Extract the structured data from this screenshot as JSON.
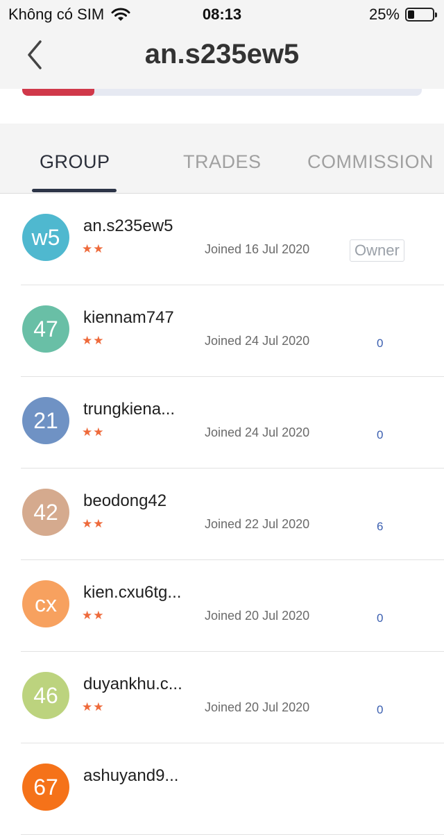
{
  "status_bar": {
    "carrier": "Không có SIM",
    "time": "08:13",
    "battery": "25%",
    "battery_level": 0.25
  },
  "header": {
    "title": "an.s235ew5"
  },
  "progress": {
    "level": 0.18
  },
  "tabs": [
    {
      "label": "GROUP",
      "active": true
    },
    {
      "label": "TRADES",
      "active": false
    },
    {
      "label": "COMMISSION",
      "active": false
    }
  ],
  "members": [
    {
      "initials": "w5",
      "name": "an.s235ew5",
      "stars": "★★",
      "joined": "Joined 16 Jul 2020",
      "badge": "Owner",
      "count": "",
      "color": "#4fb8cf"
    },
    {
      "initials": "47",
      "name": "kiennam747",
      "stars": "★★",
      "joined": "Joined 24 Jul 2020",
      "badge": "",
      "count": "0",
      "color": "#69bfa6"
    },
    {
      "initials": "21",
      "name": "trungkiena...",
      "stars": "★★",
      "joined": "Joined 24 Jul 2020",
      "badge": "",
      "count": "0",
      "color": "#6f92c4"
    },
    {
      "initials": "42",
      "name": "beodong42",
      "stars": "★★",
      "joined": "Joined 22 Jul 2020",
      "badge": "",
      "count": "6",
      "color": "#d5aa8e"
    },
    {
      "initials": "cx",
      "name": "kien.cxu6tg...",
      "stars": "★★",
      "joined": "Joined 20 Jul 2020",
      "badge": "",
      "count": "0",
      "color": "#f7a15f"
    },
    {
      "initials": "46",
      "name": "duyankhu.c...",
      "stars": "★★",
      "joined": "Joined 20 Jul 2020",
      "badge": "",
      "count": "0",
      "color": "#bcd37e"
    },
    {
      "initials": "67",
      "name": "ashuyand9...",
      "stars": "",
      "joined": "",
      "badge": "",
      "count": "",
      "color": "#f57219"
    }
  ]
}
